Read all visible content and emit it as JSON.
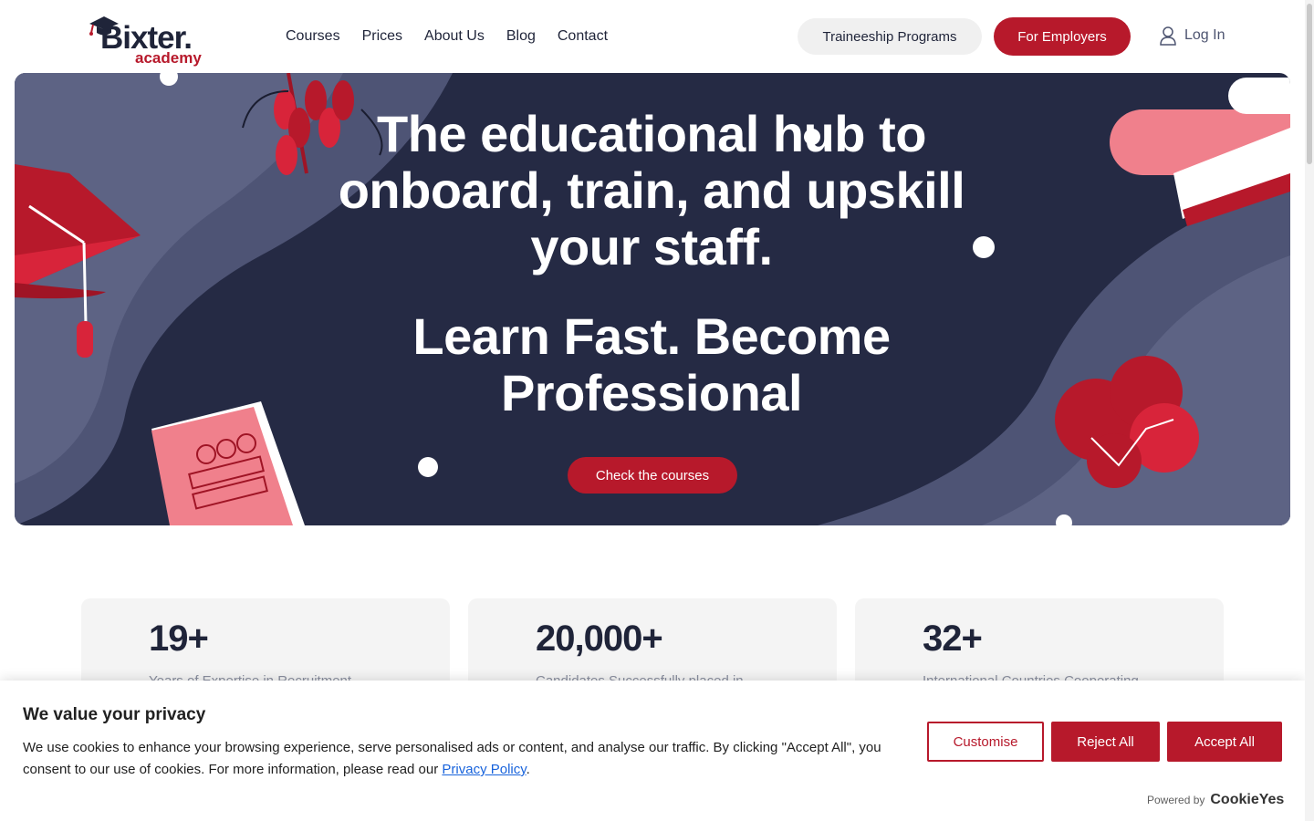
{
  "header": {
    "logo_text": "Bixter.",
    "logo_sub": "academy",
    "nav": [
      "Courses",
      "Prices",
      "About Us",
      "Blog",
      "Contact"
    ],
    "traineeship_label": "Traineeship Programs",
    "employers_label": "For Employers",
    "login_label": "Log In"
  },
  "hero": {
    "title": "The educational hub to onboard, train, and upskill your staff.",
    "subtitle": "Learn Fast. Become Professional",
    "cta_label": "Check the courses"
  },
  "stats": [
    {
      "value": "19+",
      "desc": "Years of Expertise in Recruitment"
    },
    {
      "value": "20,000+",
      "desc": "Candidates Successfully placed in"
    },
    {
      "value": "32+",
      "desc": "International Countries Cooperating"
    }
  ],
  "cookie": {
    "title": "We value your privacy",
    "text_before": "We use cookies to enhance your browsing experience, serve personalised ads or content, and analyse our traffic. By clicking \"Accept All\", you consent to our use of cookies. For more information, please read our ",
    "link_label": "Privacy Policy",
    "text_after": ".",
    "customise_label": "Customise",
    "reject_label": "Reject All",
    "accept_label": "Accept All",
    "powered_label": "Powered by",
    "powered_brand": "CookieYes"
  },
  "colors": {
    "brand_red": "#b7192b",
    "navy": "#252a44",
    "wave": "#4e5475"
  }
}
